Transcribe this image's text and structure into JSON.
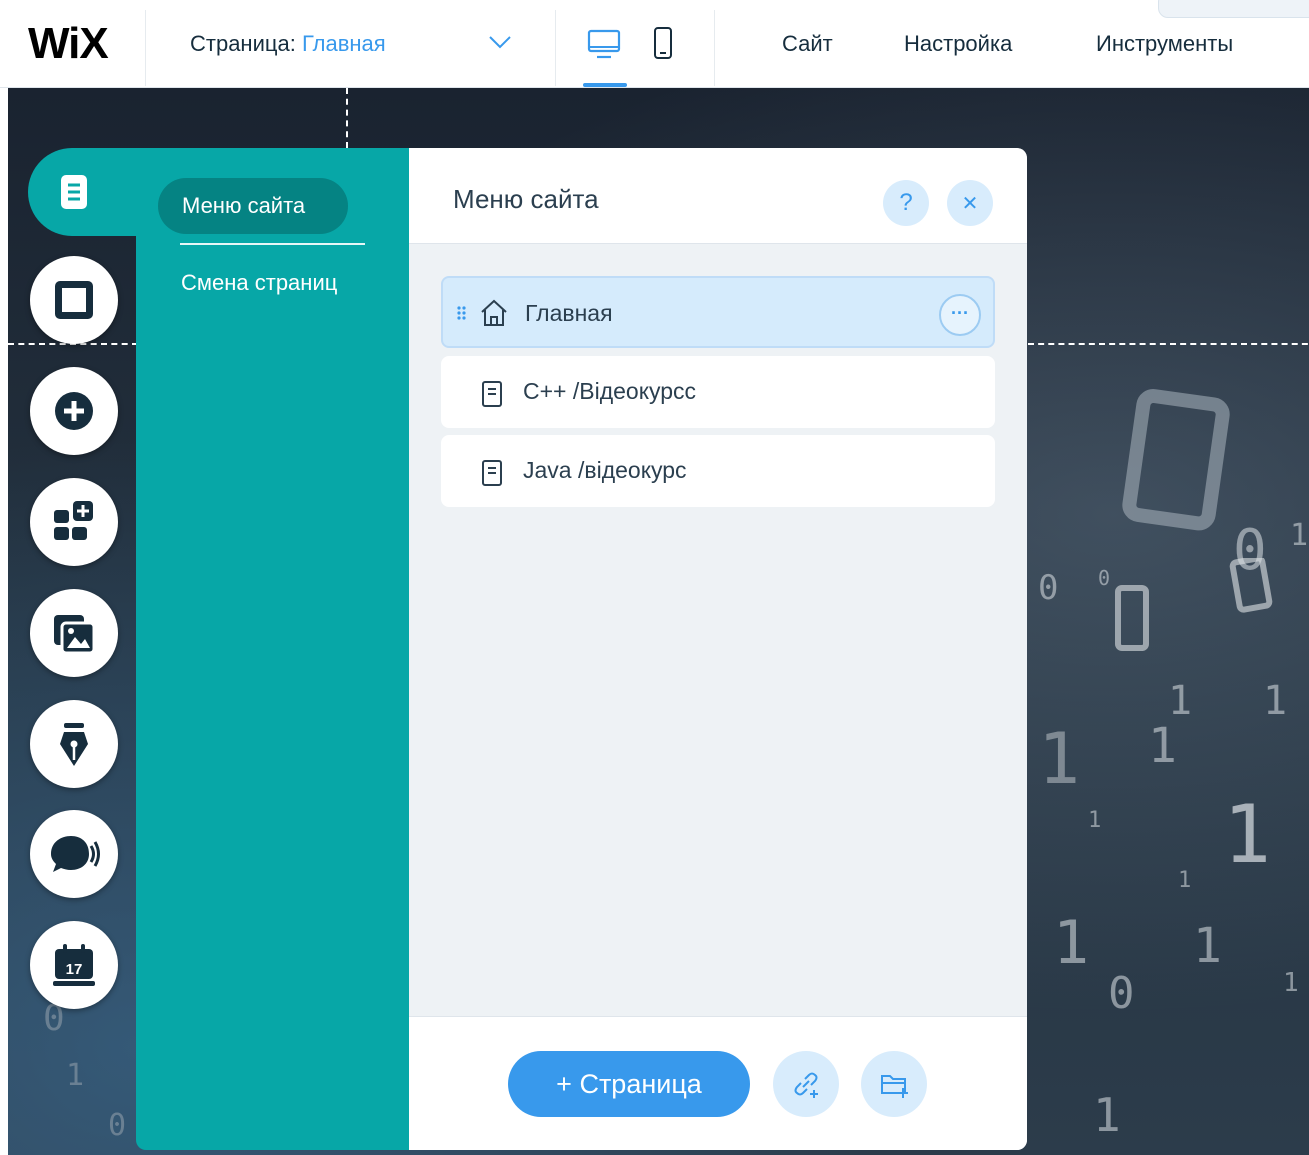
{
  "topbar": {
    "logo": "WiX",
    "page_label": "Страница:",
    "page_name": "Главная",
    "menu": [
      "Сайт",
      "Настройка",
      "Инструменты"
    ]
  },
  "icons": {
    "chevron": "chevron-down-icon",
    "desktop": "desktop-icon",
    "mobile": "mobile-icon"
  },
  "rail": {
    "items": [
      "menu-icon",
      "background-icon",
      "add-icon",
      "apps-icon",
      "media-icon",
      "blog-pen-icon",
      "chat-icon",
      "bookings-calendar-icon"
    ],
    "calendar_day": "17"
  },
  "panel": {
    "nav": {
      "active": "Меню сайта",
      "second": "Смена страниц"
    },
    "title": "Меню сайта",
    "help": "?",
    "close": "✕",
    "pages": [
      {
        "label": "Главная",
        "icon": "home-icon",
        "selected": true
      },
      {
        "label": "C++ /Відеокурсс",
        "icon": "page-icon",
        "selected": false
      },
      {
        "label": "Java /відеокурс",
        "icon": "page-icon",
        "selected": false
      }
    ],
    "more": "···",
    "add_page": "+ Страница"
  },
  "colors": {
    "accent": "#3899ec",
    "teal": "#07a7a7",
    "teal_dark": "#058383",
    "selected_row": "#d5ebfc"
  }
}
